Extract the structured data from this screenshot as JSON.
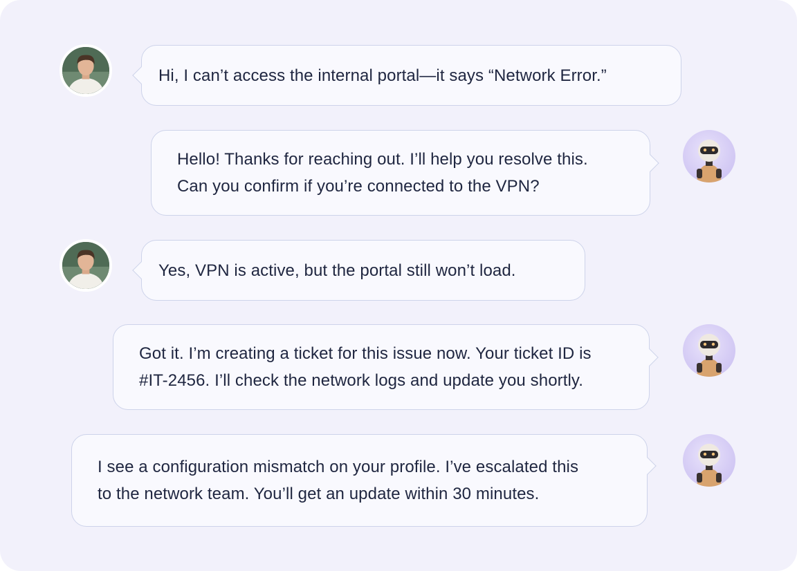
{
  "messages": [
    {
      "sender": "user",
      "avatar_icon": "user-avatar-photo",
      "text": "Hi, I can’t access the internal portal—it says “Network Error.”"
    },
    {
      "sender": "bot",
      "avatar_icon": "robot-avatar",
      "text": "Hello! Thanks for reaching out. I’ll help you resolve this.\nCan you confirm if you’re connected to the VPN?"
    },
    {
      "sender": "user",
      "avatar_icon": "user-avatar-photo",
      "text": "Yes, VPN is active, but the portal still won’t load."
    },
    {
      "sender": "bot",
      "avatar_icon": "robot-avatar",
      "text": "Got it. I’m creating a ticket for this issue now. Your ticket ID is\n#IT-2456. I’ll check the network logs and update you shortly."
    },
    {
      "sender": "bot",
      "avatar_icon": "robot-avatar",
      "text": "I see a configuration mismatch on your profile. I’ve escalated this\nto the network team. You’ll get an update within 30 minutes."
    }
  ],
  "colors": {
    "panel_background": "#f2f1fb",
    "bubble_background": "#f9f9fe",
    "bubble_border": "#cdd3ea",
    "text": "#1f2640",
    "bot_avatar_background": "#d6cdf5"
  }
}
